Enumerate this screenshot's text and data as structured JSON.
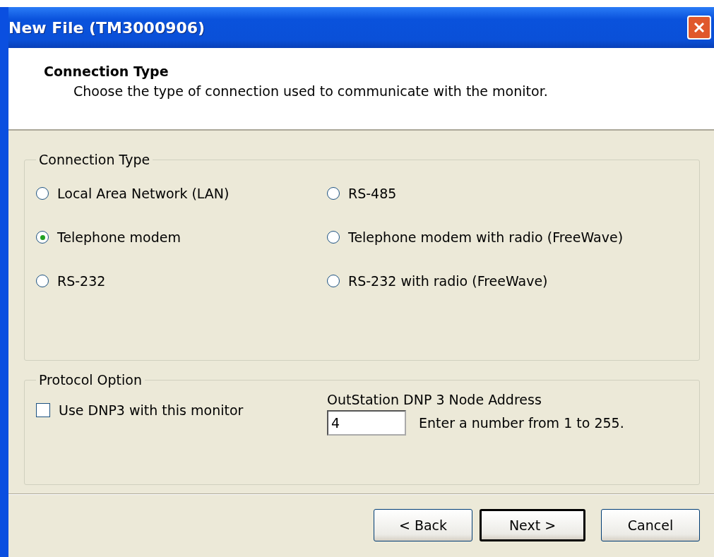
{
  "window": {
    "title": "New File (TM3000906)"
  },
  "header": {
    "title": "Connection Type",
    "subtitle": "Choose the type of connection used to communicate with the monitor."
  },
  "connection_type": {
    "legend": "Connection Type",
    "options": [
      {
        "label": "Local Area Network (LAN)",
        "selected": false
      },
      {
        "label": "RS-485",
        "selected": false
      },
      {
        "label": "Telephone modem",
        "selected": true
      },
      {
        "label": "Telephone modem with radio (FreeWave)",
        "selected": false
      },
      {
        "label": "RS-232",
        "selected": false
      },
      {
        "label": "RS-232 with radio (FreeWave)",
        "selected": false
      }
    ]
  },
  "protocol_option": {
    "legend": "Protocol Option",
    "use_dnp3": {
      "label": "Use DNP3 with this monitor",
      "checked": false
    },
    "address_label": "OutStation DNP 3 Node Address",
    "address": {
      "value": "4"
    },
    "hint": "Enter a number from 1 to 255."
  },
  "buttons": [
    {
      "label": "< Back",
      "default": false
    },
    {
      "label": "Next >",
      "default": true
    },
    {
      "label": "Cancel",
      "default": false
    }
  ]
}
